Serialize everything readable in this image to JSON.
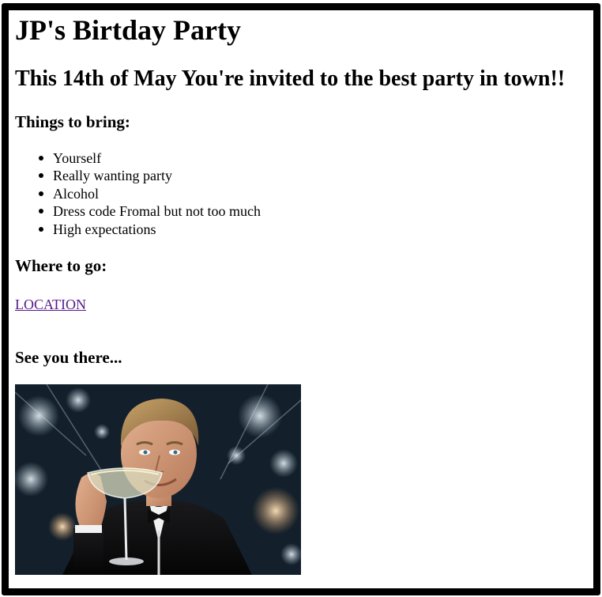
{
  "page": {
    "title": "JP's Birtday Party",
    "subtitle": "This 14th of May You're invited to the best party in town!!",
    "things_title": "Things to bring:",
    "things": [
      "Yourself",
      "Really wanting party",
      "Alcohol",
      "Dress code Fromal but not too much",
      "High expectations"
    ],
    "where_title": "Where to go:",
    "location_link": "LOCATION",
    "see_you": "See you there...",
    "image": {
      "subject": "man-raising-champagne-glass"
    }
  },
  "colors": {
    "border": "#000000",
    "link_visited": "#551a8b",
    "background": "#ffffff"
  }
}
